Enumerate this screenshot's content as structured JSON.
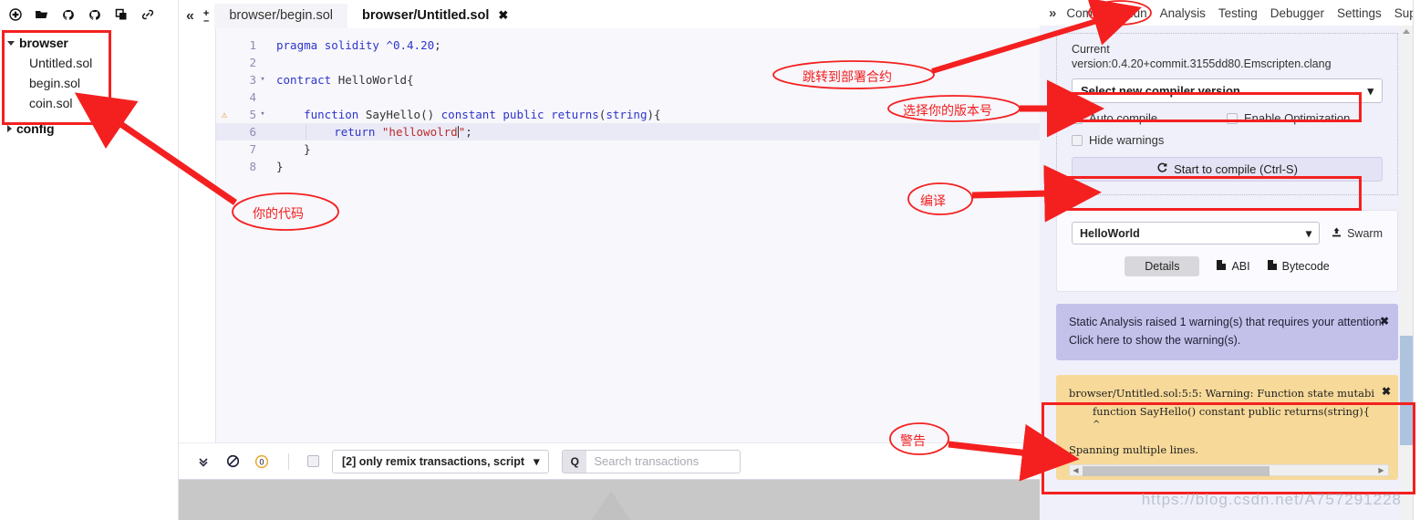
{
  "filepanel": {
    "toolbar_icons": [
      "create-file-icon",
      "open-folder-icon",
      "github-publish-icon",
      "gist-publish-icon",
      "copy-icon",
      "link-icon"
    ],
    "tree": [
      {
        "label": "browser",
        "type": "folder",
        "expanded": true,
        "children": [
          {
            "label": "Untitled.sol",
            "type": "file"
          },
          {
            "label": "begin.sol",
            "type": "file"
          },
          {
            "label": "coin.sol",
            "type": "file"
          }
        ]
      },
      {
        "label": "config",
        "type": "folder",
        "expanded": false,
        "children": []
      }
    ]
  },
  "editor": {
    "collapse_label": "«",
    "zoom_in": "+",
    "zoom_out": "–",
    "tabs": [
      {
        "label": "browser/begin.sol",
        "active": false
      },
      {
        "label": "browser/Untitled.sol",
        "active": true,
        "close": "✖"
      }
    ],
    "lines": [
      {
        "n": "1",
        "fold": "",
        "warn": "",
        "highlight": false,
        "text": "pragma solidity ^0.4.20;"
      },
      {
        "n": "2",
        "fold": "",
        "warn": "",
        "highlight": false,
        "text": ""
      },
      {
        "n": "3",
        "fold": "▾",
        "warn": "",
        "highlight": false,
        "text": "contract HelloWorld{"
      },
      {
        "n": "4",
        "fold": "",
        "warn": "",
        "highlight": false,
        "text": ""
      },
      {
        "n": "5",
        "fold": "▾",
        "warn": "⚠",
        "highlight": false,
        "text": "    function SayHello() constant public returns(string){"
      },
      {
        "n": "6",
        "fold": "",
        "warn": "",
        "highlight": true,
        "text": "        return \"hellowolrd\";"
      },
      {
        "n": "7",
        "fold": "",
        "warn": "",
        "highlight": false,
        "text": "    }"
      },
      {
        "n": "8",
        "fold": "",
        "warn": "",
        "highlight": false,
        "text": "}"
      }
    ]
  },
  "termbar": {
    "icons": [
      "chevron-double-down-icon",
      "ban-icon",
      "zero-count-icon"
    ],
    "checkbox_checked": false,
    "filter_label": "[2] only remix transactions, script",
    "filter_caret": "▾",
    "search_icon": "Q",
    "search_value": "",
    "search_placeholder": "Search transactions"
  },
  "right": {
    "chevron": "»",
    "tabs": [
      {
        "label": "Compile",
        "active": false
      },
      {
        "label": "Run",
        "active": false
      },
      {
        "label": "Analysis",
        "active": false
      },
      {
        "label": "Testing",
        "active": false
      },
      {
        "label": "Debugger",
        "active": false
      },
      {
        "label": "Settings",
        "active": false
      },
      {
        "label": "Suppo",
        "active": false
      }
    ],
    "compiler": {
      "current_label": "Current",
      "current_version": "version:0.4.20+commit.3155dd80.Emscripten.clang",
      "select_version_label": "Select new compiler version",
      "select_caret": "▾",
      "auto_compile_label": "Auto compile",
      "enable_optimization_label": "Enable Optimization",
      "hide_warnings_label": "Hide warnings",
      "compile_button_label": "Start to compile (Ctrl-S)",
      "compile_button_icon": "refresh-icon"
    },
    "contract": {
      "selected": "HelloWorld",
      "caret": "▾",
      "swarm_label": "Swarm",
      "swarm_icon": "upload-icon",
      "details_label": "Details",
      "abi_label": "ABI",
      "bytecode_label": "Bytecode",
      "copy_icon": "copy-file-icon"
    },
    "static_analysis": {
      "line1": "Static Analysis raised 1 warning(s) that requires your attention.",
      "line2": "Click here to show the warning(s).",
      "close": "✖"
    },
    "warning": {
      "line1": "browser/Untitled.sol:5:5: Warning: Function state mutabi",
      "line2": "function SayHello() constant public returns(string){",
      "line3": "^",
      "line4": "Spanning multiple lines.",
      "close": "✖",
      "scroll_left": "◀",
      "scroll_right": "▶"
    }
  },
  "annotations": [
    {
      "id": "ann-jump-deploy",
      "text": "跳转到部署合约"
    },
    {
      "id": "ann-select-version",
      "text": "选择你的版本号"
    },
    {
      "id": "ann-your-code",
      "text": "你的代码"
    },
    {
      "id": "ann-compile",
      "text": "编译"
    },
    {
      "id": "ann-warning",
      "text": "警告"
    }
  ],
  "watermark": "https://blog.csdn.net/A757291228",
  "colors": {
    "annotation_red": "#f42020",
    "panel_bg": "#eff0fa",
    "editor_bg": "#f7f7fc",
    "warning_bg": "#f7d999",
    "static_analysis_bg": "#c3c1ea"
  }
}
